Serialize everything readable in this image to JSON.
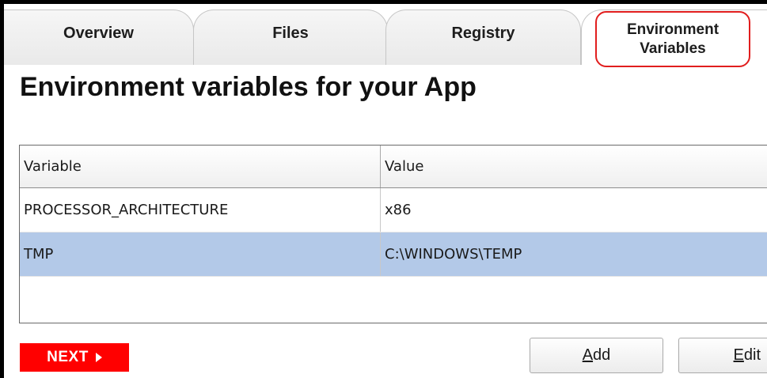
{
  "tabs": {
    "overview": "Overview",
    "files": "Files",
    "registry": "Registry",
    "env_line1": "Environment",
    "env_line2": "Variables"
  },
  "page_title": "Environment variables for your App",
  "grid": {
    "columns": [
      "Variable",
      "Value"
    ],
    "rows": [
      {
        "variable": "PROCESSOR_ARCHITECTURE",
        "value": "x86"
      },
      {
        "variable": "TMP",
        "value": "C:\\WINDOWS\\TEMP"
      }
    ],
    "selected_row": 1
  },
  "buttons": {
    "next": "NEXT",
    "add_mnemonic": "A",
    "add_rest": "dd",
    "edit_mnemonic": "E",
    "edit_rest": "dit"
  },
  "colors": {
    "accent_red": "#ff0000",
    "highlight_outline": "#e11e1e",
    "selected_row": "#b3c9e8"
  }
}
